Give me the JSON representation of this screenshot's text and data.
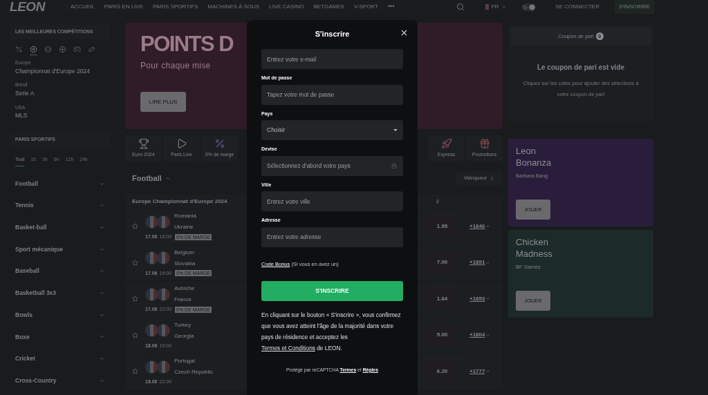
{
  "nav": {
    "logo": "LEON",
    "items": [
      "ACCUEIL",
      "PARIS EN LIVE",
      "PARIS SPORTIFS",
      "MACHINES À SOUS",
      "LIVE CASINO",
      "BETGAMES",
      "V-SPORT"
    ],
    "more": "•••",
    "language": "FR",
    "dark_mode": true,
    "login": "SE CONNECTER",
    "signup": "S'INSCRIRE"
  },
  "sidebar": {
    "top_title": "LES MEILLEURES COMPÉTITIONS",
    "competition_tabs": [
      {
        "kind": "margin",
        "selected": false
      },
      {
        "kind": "football",
        "selected": true
      },
      {
        "kind": "tennis",
        "selected": false
      },
      {
        "kind": "basketball",
        "selected": false
      },
      {
        "kind": "esport",
        "selected": false
      },
      {
        "kind": "hockey",
        "selected": false
      }
    ],
    "competitions": [
      {
        "region": "Europe",
        "name": "Championnat d'Europe 2024"
      },
      {
        "region": "Brésil",
        "name": "Serie A"
      },
      {
        "region": "USA",
        "name": "MLS"
      }
    ],
    "sports_title": "PARIS SPORTIFS",
    "filters": [
      {
        "label": "Tout",
        "selected": true
      },
      {
        "label": "1h",
        "selected": false
      },
      {
        "label": "3h",
        "selected": false
      },
      {
        "label": "6h",
        "selected": false
      },
      {
        "label": "12h",
        "selected": false
      },
      {
        "label": "24h",
        "selected": false
      }
    ],
    "sports": [
      "Football",
      "Tennis",
      "Basket-ball",
      "Sport mécanique",
      "Baseball",
      "Basketball 3x3",
      "Bowls",
      "Boxe",
      "Cricket",
      "Cross-Country"
    ]
  },
  "banner": {
    "title": "POINTS D",
    "subtitle": "Pour chaque mise",
    "button": "LIRE PLUS"
  },
  "quick_links": [
    {
      "kind": "euro",
      "label": "Euro 2024"
    },
    {
      "kind": "live",
      "label": "Paris Live"
    },
    {
      "kind": "margin",
      "label": "0% de marge"
    },
    {
      "kind": "express",
      "label": "Express"
    },
    {
      "kind": "promotions",
      "label": "Promotions"
    }
  ],
  "events": {
    "sport": "Football",
    "market": "Vainqueur",
    "league_region": "Europe",
    "league_name": "Championnat d'Europe 2024",
    "column": "2",
    "matches": [
      {
        "team_1": "Romania",
        "team_2": "Ukraine",
        "date": "17.06",
        "time": "16:00",
        "badge": "0% DE MARGE",
        "odd": "1.95",
        "more": "+1846"
      },
      {
        "team_1": "Belgium",
        "team_2": "Slovakia",
        "date": "17.06",
        "time": "19:00",
        "badge": "0% DE MARGE",
        "odd": "7.00",
        "more": "+1891"
      },
      {
        "team_1": "Autriche",
        "team_2": "France",
        "date": "17.06",
        "time": "22:00",
        "badge": "0% DE MARGE",
        "odd": "1.64",
        "more": "+1853"
      },
      {
        "team_1": "Turkey",
        "team_2": "Georgia",
        "date": "18.06",
        "time": "19:00",
        "odd": "5.00",
        "more": "+1804"
      },
      {
        "team_1": "Portugal",
        "team_2": "Czech Republic",
        "date": "18.06",
        "time": "22:00",
        "odd": "6.20",
        "more": "+1777"
      }
    ]
  },
  "coupon": {
    "title": "Coupon de pari",
    "count": "0",
    "empty_title": "Le coupon de pari est vide",
    "empty_text": "Cliquez sur les cotes pour ajouter des sélections à votre coupon de pari"
  },
  "games": [
    {
      "title": "Leon Bonanza",
      "provider": "Barbara Bang",
      "button": "JOUER",
      "color": "#2a1d3c"
    },
    {
      "title": "Chicken Madness",
      "provider": "BF Games",
      "button": "JOUER",
      "color": "#1d2a2a"
    }
  ],
  "dialog": {
    "title": "S'inscrire",
    "fields": [
      {
        "kind": "text",
        "placeholder": "Entrez votre e-mail"
      },
      {
        "kind": "password",
        "label": "Mot de passe",
        "placeholder": "Tapez votre mot de passe"
      },
      {
        "kind": "select",
        "label": "Pays",
        "value": "Choisir"
      },
      {
        "kind": "locked",
        "label": "Devise",
        "placeholder": "Sélectionnez d'abord votre pays"
      },
      {
        "kind": "text",
        "label": "Ville",
        "placeholder": "Entrez votre ville"
      },
      {
        "kind": "text",
        "label": "Adresse",
        "placeholder": "Entrez votre adresse"
      }
    ],
    "bonus_link": "Code Bonus",
    "bonus_note": "(Si vous en avez un)",
    "submit": "S'INSCRIRE",
    "consent_before": "En cliquant sur le bouton « S'inscrire », vous confirmez que vous avez atteint l'âge de la majorité dans votre pays de résidence et acceptez les",
    "consent_link": "Termes et Conditions",
    "consent_after": "de LEON.",
    "recaptcha_text": "Protégé par reCAPTCHA",
    "recaptcha_terms": "Termes",
    "recaptcha_and": "et",
    "recaptcha_rules": "Règles"
  }
}
